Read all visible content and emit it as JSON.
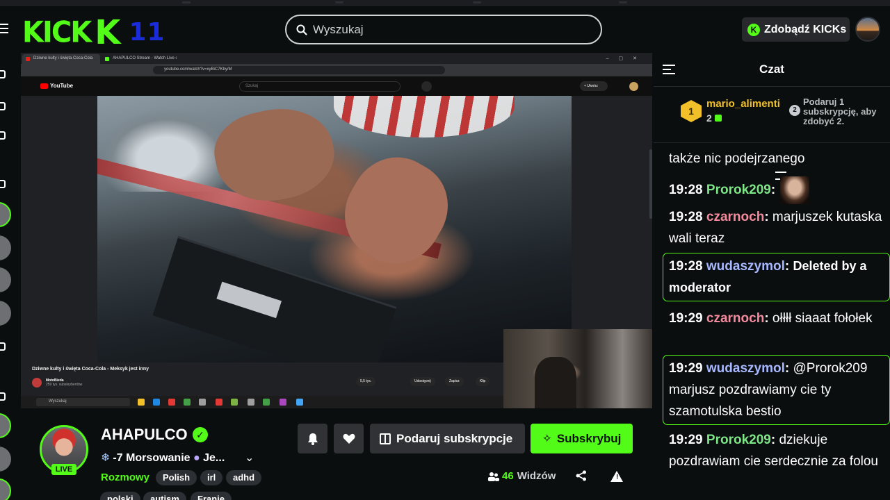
{
  "header": {
    "logo_text": "KICK",
    "logo_mark": "K",
    "logo_number": "11",
    "search_placeholder": "Wyszukaj",
    "kicks_button": "Zdobądź KICKs",
    "accent_color": "#53fc18",
    "number_color": "#1a2bd9"
  },
  "video": {
    "browser_tab_1": "Dziwne kulty i święta Coca-Cola",
    "browser_tab_2": "AHAPULCO Stream - Watch Live on",
    "browser_url": "youtube.com/watch?v=xyBiC7Kby/M",
    "yt_logo": "YouTube",
    "yt_search_placeholder": "Szukaj",
    "yt_create": "+ Utwórz",
    "yt_video_title": "Dziwne kulty i święta Coca-Cola - Meksyk jest inny",
    "yt_channel": "MotoBieda",
    "yt_subs": "259 tys. subskrybentów",
    "yt_likes": "5,5 tys.",
    "yt_share": "Udostępnij",
    "yt_save": "Zapisz",
    "yt_clip": "Klip",
    "taskbar_search": "Wyszukaj"
  },
  "stream": {
    "streamer_name": "AHAPULCO",
    "live_badge": "LIVE",
    "title": "-7 Morsowanie",
    "title_suffix": "Je...",
    "category": "Rozmowy",
    "tags": [
      "Polish",
      "irl",
      "adhd",
      "polski",
      "autism",
      "Franie"
    ],
    "gift_button": "Podaruj subskrypcje",
    "subscribe_button": "Subskrybuj",
    "viewer_count": "46",
    "viewer_label": "Widzów"
  },
  "chat": {
    "title": "Czat",
    "top_gifter": {
      "rank": "1",
      "username": "mario_alimenti",
      "count": "2"
    },
    "goal": {
      "number": "2",
      "text": "Podaruj 1 subskrypcję, aby zdobyć 2."
    },
    "messages": [
      {
        "time": "",
        "user": "",
        "user_color": "#ffffff",
        "text": "także nic podejrzanego"
      },
      {
        "time": "19:28",
        "user": "Prorok209",
        "user_color": "#7ce687",
        "text": ""
      },
      {
        "time": "19:28",
        "user": "czarnoch",
        "user_color": "#f58a9e",
        "text": "marjuszek kutaska wali teraz"
      },
      {
        "time": "19:28",
        "user": "wudaszymol",
        "user_color": "#a8b8ff",
        "text": "Deleted by a moderator"
      },
      {
        "time": "19:29",
        "user": "czarnoch",
        "user_color": "#f58a9e",
        "text": "ołłłł siaaat fołołek"
      },
      {
        "time": "19:29",
        "user": "wudaszymol",
        "user_color": "#a8b8ff",
        "text": "@Prorok209 marjusz pozdrawiamy cie ty szamotulska bestio"
      },
      {
        "time": "19:29",
        "user": "Prorok209",
        "user_color": "#7ce687",
        "text": "dziekuje pozdrawiam cie serdecznie za folou"
      }
    ]
  }
}
